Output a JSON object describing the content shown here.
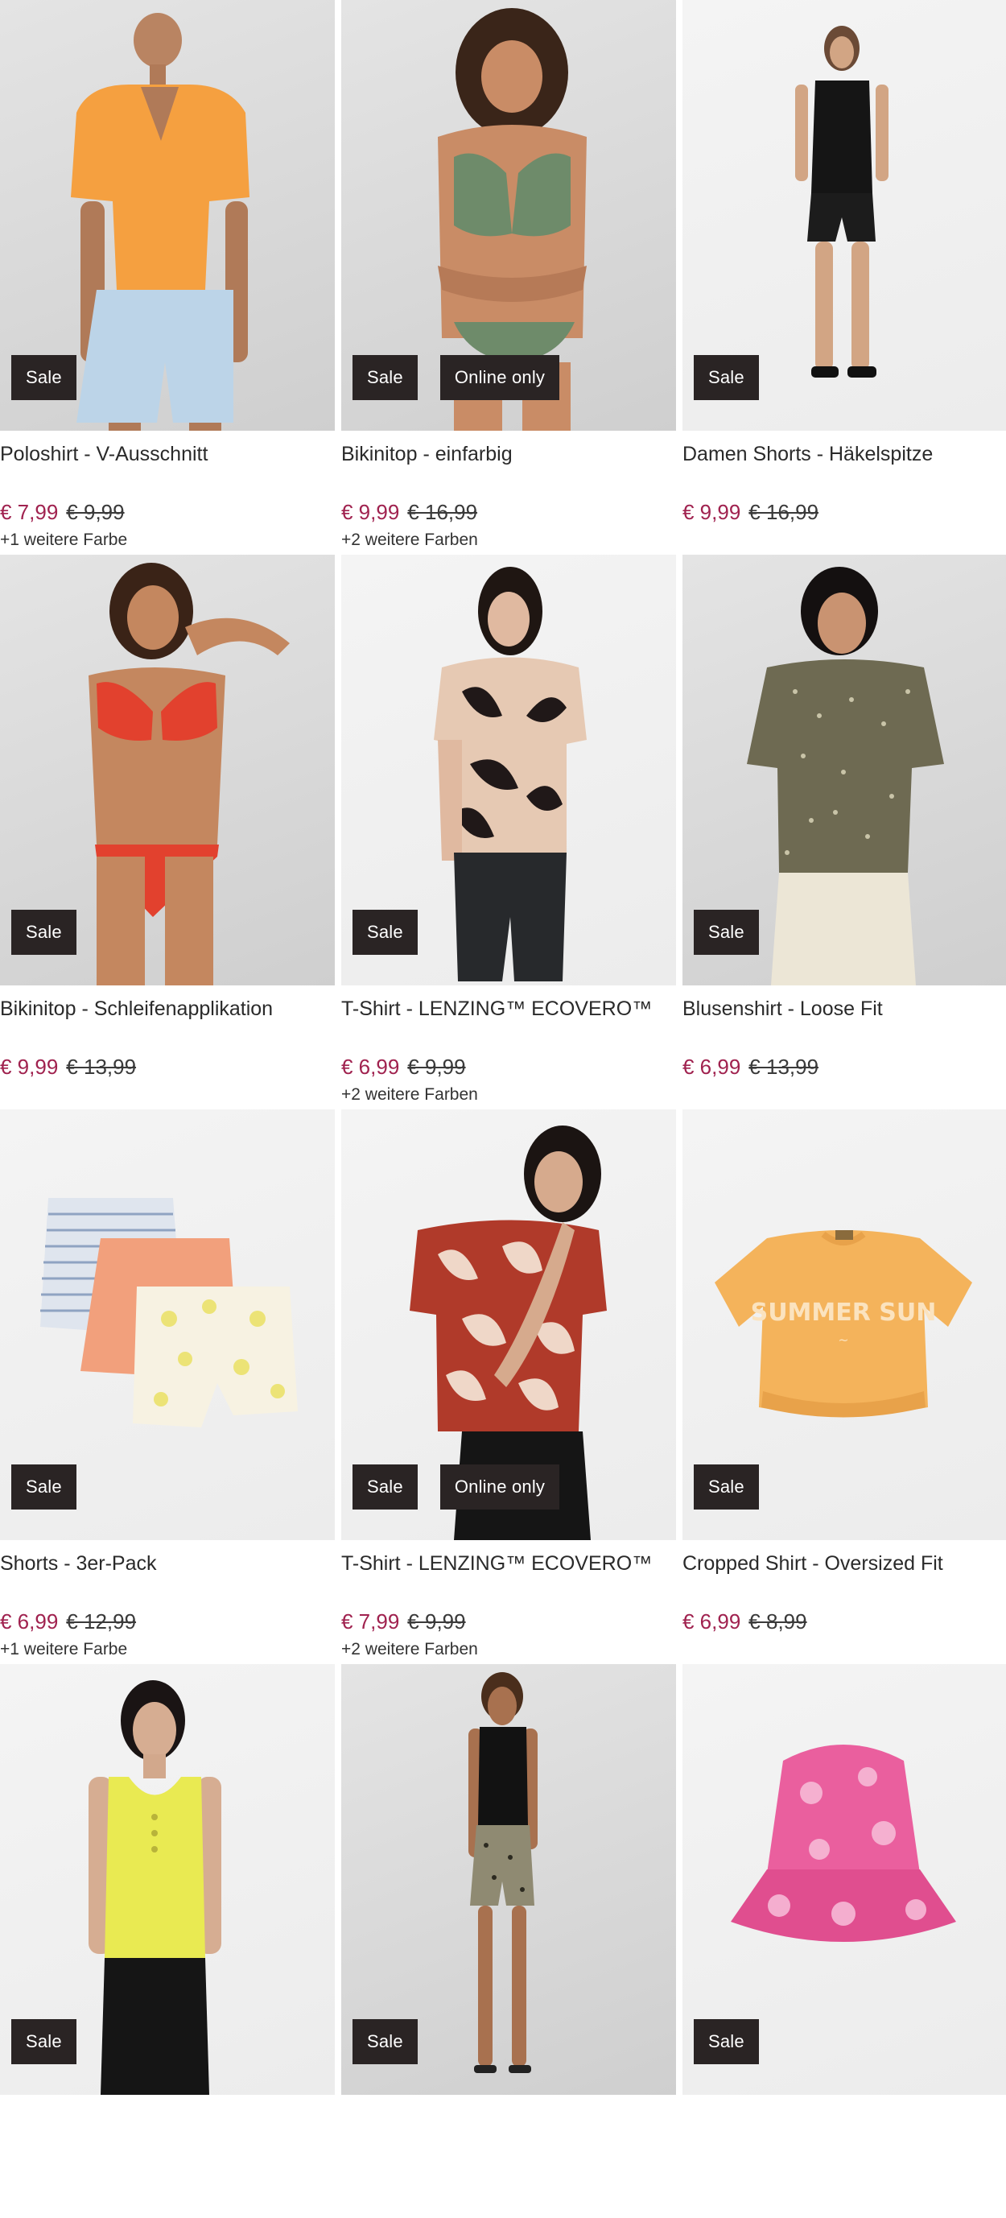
{
  "products": [
    {
      "name": "Poloshirt - V-Ausschnitt",
      "price": "€ 7,99",
      "old_price": "€ 9,99",
      "colors": "+1 weitere Farbe",
      "badges": [
        "Sale"
      ],
      "image": "model-orange-polo-denim-shorts"
    },
    {
      "name": "Bikinitop - einfarbig",
      "price": "€ 9,99",
      "old_price": "€ 16,99",
      "colors": "+2 weitere Farben",
      "badges": [
        "Sale",
        "Online only"
      ],
      "image": "model-green-bikini"
    },
    {
      "name": "Damen Shorts - Häkelspitze",
      "price": "€ 9,99",
      "old_price": "€ 16,99",
      "colors": "",
      "badges": [
        "Sale"
      ],
      "image": "model-black-top-shorts"
    },
    {
      "name": "Bikinitop - Schleifenapplikation",
      "price": "€ 9,99",
      "old_price": "€ 13,99",
      "colors": "",
      "badges": [
        "Sale"
      ],
      "image": "model-red-bikini"
    },
    {
      "name": "T-Shirt - LENZING™ ECOVERO™",
      "price": "€ 6,99",
      "old_price": "€ 9,99",
      "colors": "+2 weitere Farben",
      "badges": [
        "Sale"
      ],
      "image": "model-beige-leaf-print-shirt"
    },
    {
      "name": "Blusenshirt - Loose Fit",
      "price": "€ 6,99",
      "old_price": "€ 13,99",
      "colors": "",
      "badges": [
        "Sale"
      ],
      "image": "model-olive-floral-blouse"
    },
    {
      "name": "Shorts - 3er-Pack",
      "price": "€ 6,99",
      "old_price": "€ 12,99",
      "colors": "+1 weitere Farbe",
      "badges": [
        "Sale"
      ],
      "image": "three-pack-shorts"
    },
    {
      "name": "T-Shirt - LENZING™ ECOVERO™",
      "price": "€ 7,99",
      "old_price": "€ 9,99",
      "colors": "+2 weitere Farben",
      "badges": [
        "Sale",
        "Online only"
      ],
      "image": "model-red-leaf-print-shirt"
    },
    {
      "name": "Cropped Shirt - Oversized Fit",
      "price": "€ 6,99",
      "old_price": "€ 8,99",
      "colors": "",
      "badges": [
        "Sale"
      ],
      "image": "yellow-summer-sun-shirt",
      "print_text": "SUMMER SUN"
    },
    {
      "name": "",
      "price": "",
      "old_price": "",
      "colors": "",
      "badges": [
        "Sale"
      ],
      "image": "model-yellow-tank-top"
    },
    {
      "name": "",
      "price": "",
      "old_price": "",
      "colors": "",
      "badges": [
        "Sale"
      ],
      "image": "model-black-tank-khaki-shorts"
    },
    {
      "name": "",
      "price": "",
      "old_price": "",
      "colors": "",
      "badges": [
        "Sale"
      ],
      "image": "pink-floral-bucket-hat"
    }
  ],
  "colors": {
    "price": "#a0224f",
    "badge_bg": "#2a2424"
  }
}
